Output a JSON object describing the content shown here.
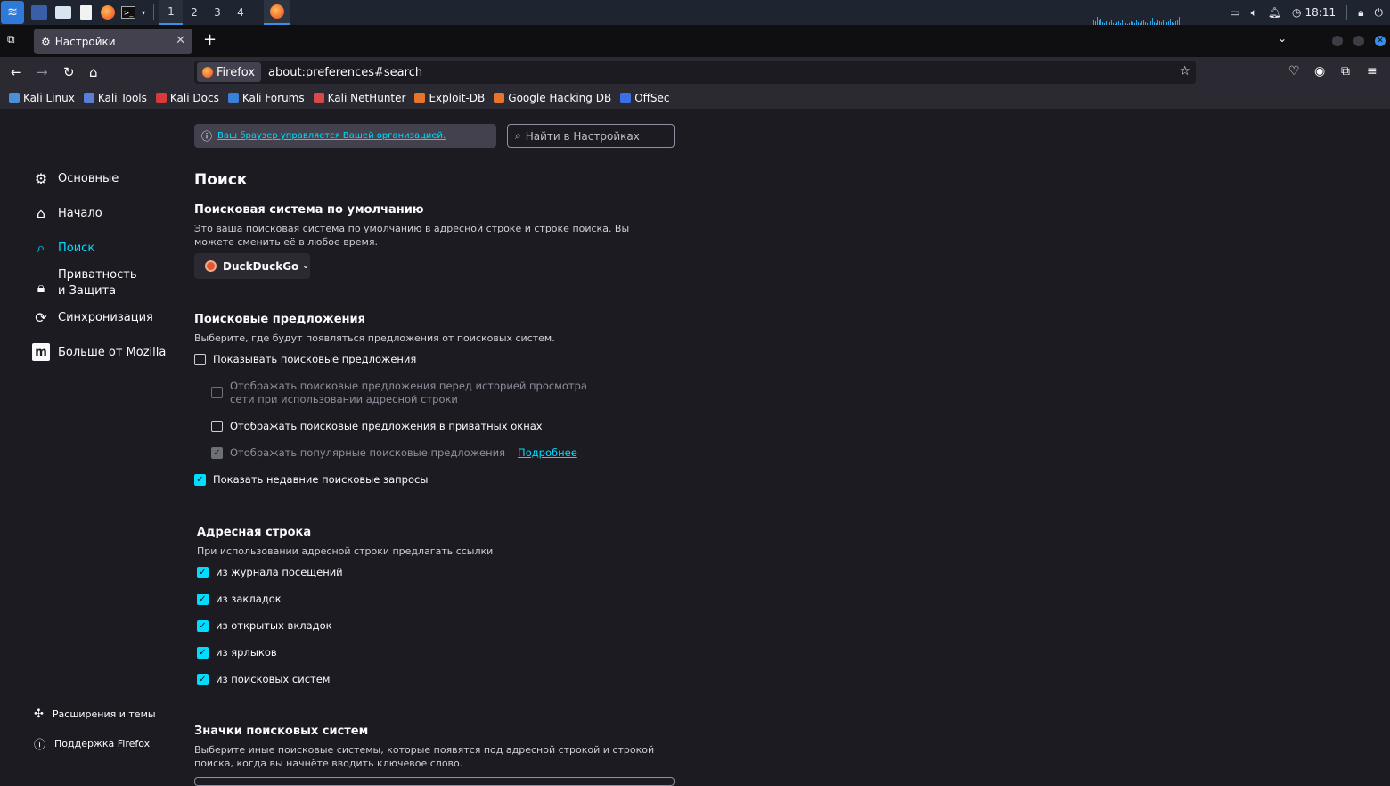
{
  "taskbar": {
    "workspaces": [
      "1",
      "2",
      "3",
      "4"
    ],
    "clock": "18:11"
  },
  "tab": {
    "title": "Настройки"
  },
  "navbar": {
    "identity_label": "Firefox",
    "url": "about:preferences#search"
  },
  "bookmarks": [
    {
      "label": "Kali Linux",
      "color": "#4a8fd8"
    },
    {
      "label": "Kali Tools",
      "color": "#5a7fd8"
    },
    {
      "label": "Kali Docs",
      "color": "#d83a3a"
    },
    {
      "label": "Kali Forums",
      "color": "#3a7fd8"
    },
    {
      "label": "Kali NetHunter",
      "color": "#d84a4a"
    },
    {
      "label": "Exploit-DB",
      "color": "#e8742a"
    },
    {
      "label": "Google Hacking DB",
      "color": "#e8742a"
    },
    {
      "label": "OffSec",
      "color": "#3a6fe8"
    }
  ],
  "sidebar": {
    "items": [
      {
        "label": "Основные",
        "icon": "gear-icon"
      },
      {
        "label": "Начало",
        "icon": "home-icon"
      },
      {
        "label": "Поиск",
        "icon": "search-icon"
      },
      {
        "label": "Приватность и Защита",
        "icon": "lock-icon"
      },
      {
        "label": "Синхронизация",
        "icon": "sync-icon"
      },
      {
        "label": "Больше от Mozilla",
        "icon": "mozilla-icon"
      }
    ],
    "footer": [
      {
        "label": "Расширения и темы",
        "icon": "puzzle-icon"
      },
      {
        "label": "Поддержка Firefox",
        "icon": "help-icon"
      }
    ]
  },
  "policy_notice": "Ваш браузер управляется Вашей организацией.",
  "find_placeholder": "Найти в Настройках",
  "page_title": "Поиск",
  "default_engine": {
    "heading": "Поисковая система по умолчанию",
    "description": "Это ваша поисковая система по умолчанию в адресной строке и строке поиска. Вы можете сменить её в любое время.",
    "selected": "DuckDuckGo"
  },
  "suggestions": {
    "heading": "Поисковые предложения",
    "description": "Выберите, где будут появляться предложения от поисковых систем.",
    "show_suggestions": "Показывать поисковые предложения",
    "before_history": "Отображать поисковые предложения перед историей просмотра сети при использовании адресной строки",
    "private_windows": "Отображать поисковые предложения в приватных окнах",
    "trending": "Отображать популярные поисковые предложения",
    "learn_more": "Подробнее",
    "recent_searches": "Показать недавние поисковые запросы"
  },
  "address_bar": {
    "heading": "Адресная строка",
    "description": "При использовании адресной строки предлагать ссылки",
    "options": [
      "из журнала посещений",
      "из закладок",
      "из открытых вкладок",
      "из ярлыков",
      "из поисковых систем"
    ]
  },
  "shortcuts": {
    "heading": "Значки поисковых систем",
    "description": "Выберите иные поисковые системы, которые появятся под адресной строкой и строкой поиска, когда вы начнёте вводить ключевое слово."
  }
}
